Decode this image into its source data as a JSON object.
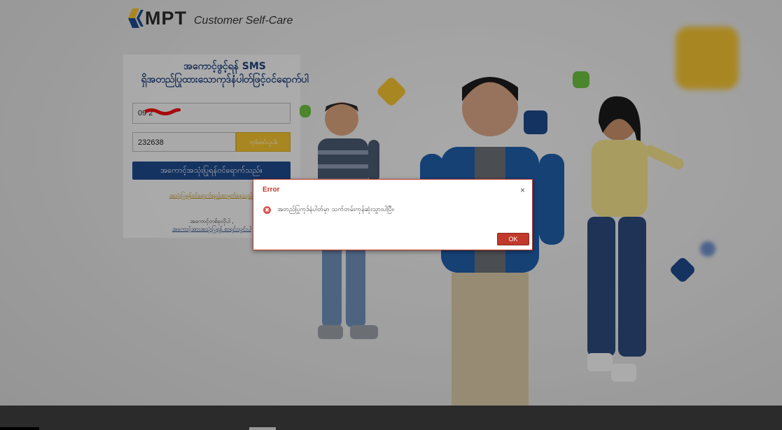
{
  "brand": {
    "logo_text": "MPT",
    "subtitle": "Customer Self-Care"
  },
  "login": {
    "title_line1": "အကောင့်ဖွင့်ရန် SMS",
    "title_line2": "ရှိအတည်ပြုထားသောကုဒ်နံပါတ်ဖြင့်ဝင်ရောက်ပါ",
    "phone_value": "09          2",
    "code_value": "232638",
    "resend_label": "ကုဒ်ထပ်ယူပါ။",
    "submit_label": "အကောင့်အသုံးပြုရန်ဝင်ရောက်သည်။",
    "forgot_link": "အသုံးပြုရန်ဝင်ရောက်ရည်းစာမှတ်နေသည်။",
    "no_account_text": "အကောင့်တစ်ခုလိုပါ ,",
    "register_link": "အကောင့်အားအသုံးပြုရန် စာရင်းသွင်းပါ"
  },
  "dialog": {
    "title": "Error",
    "close_glyph": "×",
    "icon_glyph": "✖",
    "message": "အတည်ပြုကုဒ်နံပါတ်မှာ သက်တမ်းကုန်ဆုံးသွားပါပြီ။",
    "ok_label": "OK"
  },
  "colors": {
    "brand_blue": "#1f4a8c",
    "brand_yellow": "#f1c232",
    "error_red": "#c0392b"
  },
  "icons": [
    "phone-icon",
    "close-icon",
    "error-icon"
  ]
}
